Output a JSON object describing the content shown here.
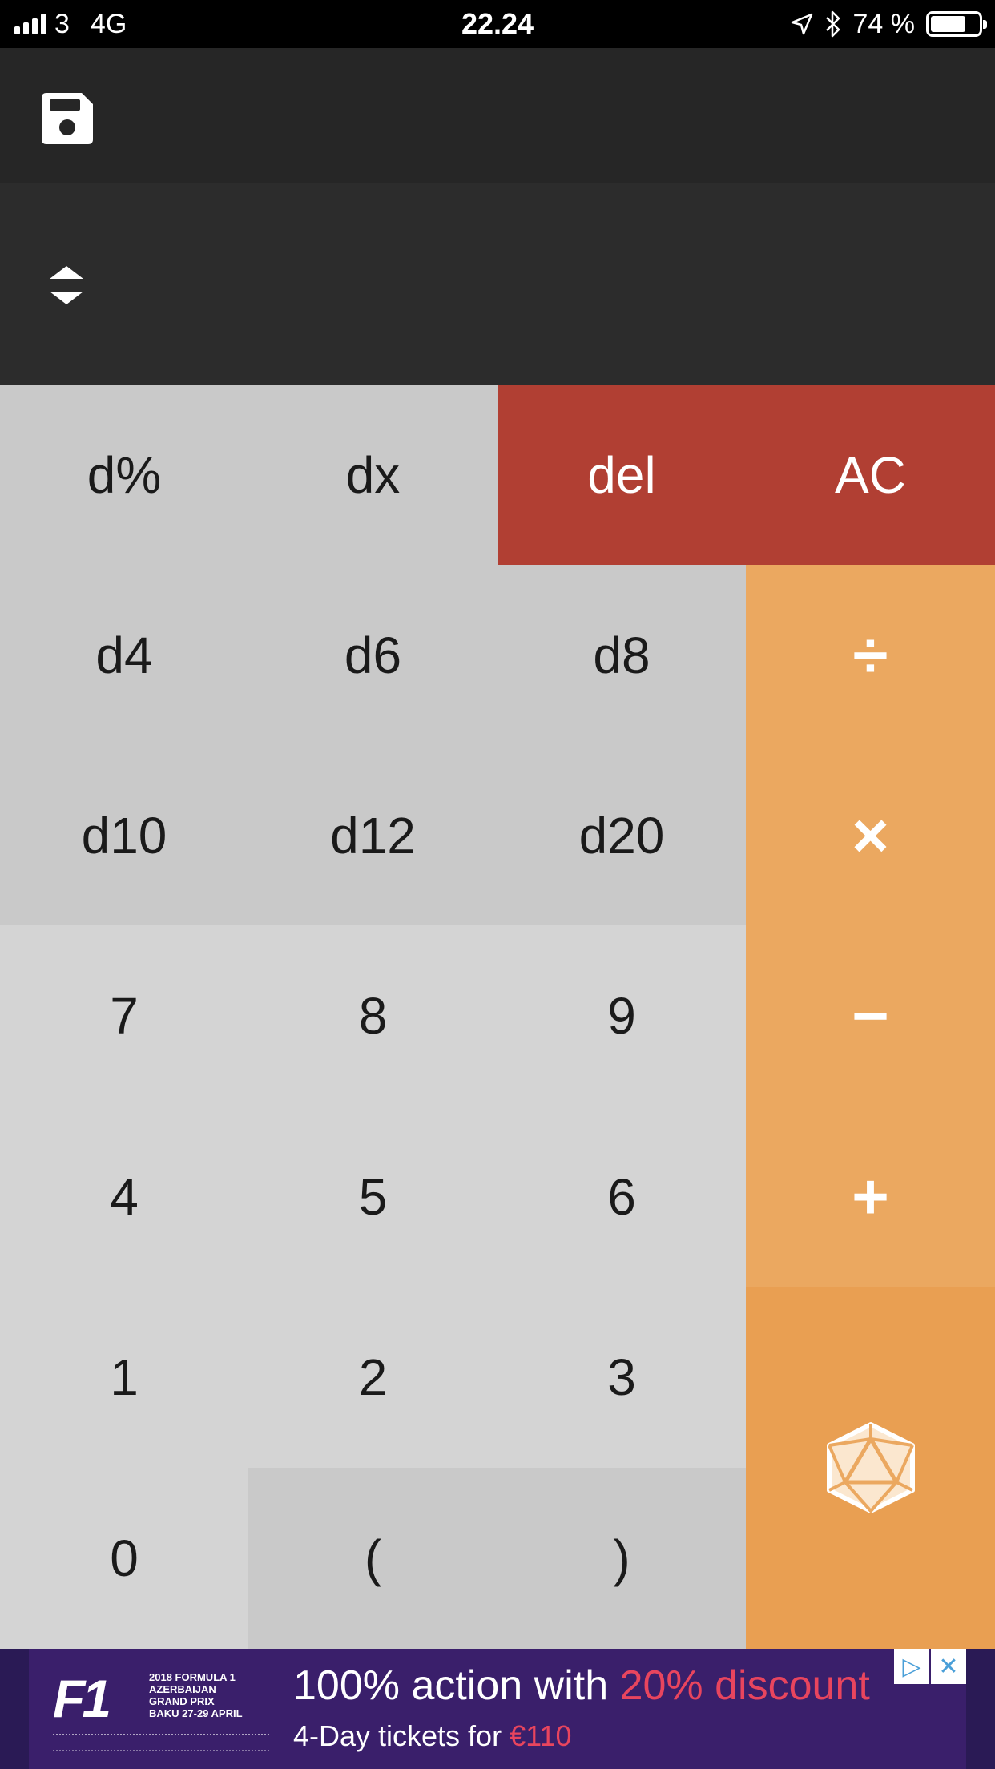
{
  "status_bar": {
    "carrier": "3",
    "network": "4G",
    "time": "22.24",
    "battery": "74 %",
    "battery_level": 0.74
  },
  "toolbar": {
    "save_icon": "floppy-disk-icon"
  },
  "display": {
    "expand_icon": "expand-collapse-icon",
    "value": ""
  },
  "keypad": {
    "row1": [
      "d%",
      "dx",
      "del",
      "AC"
    ],
    "dice": [
      "d4",
      "d6",
      "d8",
      "d10",
      "d12",
      "d20"
    ],
    "digits": [
      "7",
      "8",
      "9",
      "4",
      "5",
      "6",
      "1",
      "2",
      "3",
      "0"
    ],
    "parens": [
      "(",
      ")"
    ],
    "operators": [
      "÷",
      "×",
      "−",
      "+"
    ],
    "roll_icon": "d20-dice-icon"
  },
  "colors": {
    "function_key": "#c9c9c9",
    "digit_key": "#d4d4d4",
    "clear_key": "#b13f33",
    "operator_key": "#eba860",
    "roll_key": "#e99f52"
  },
  "ad": {
    "logo_text": "F1",
    "event_lines": "2018 FORMULA 1 AZERBAIJAN GRAND PRIX BAKU 27-29 APRIL",
    "headline_prefix": "100% action with ",
    "headline_highlight": "20% discount",
    "sub_prefix": "4-Day tickets for ",
    "sub_highlight": "€110",
    "adchoices_icon": "adchoices-icon",
    "close_icon": "close-icon"
  }
}
